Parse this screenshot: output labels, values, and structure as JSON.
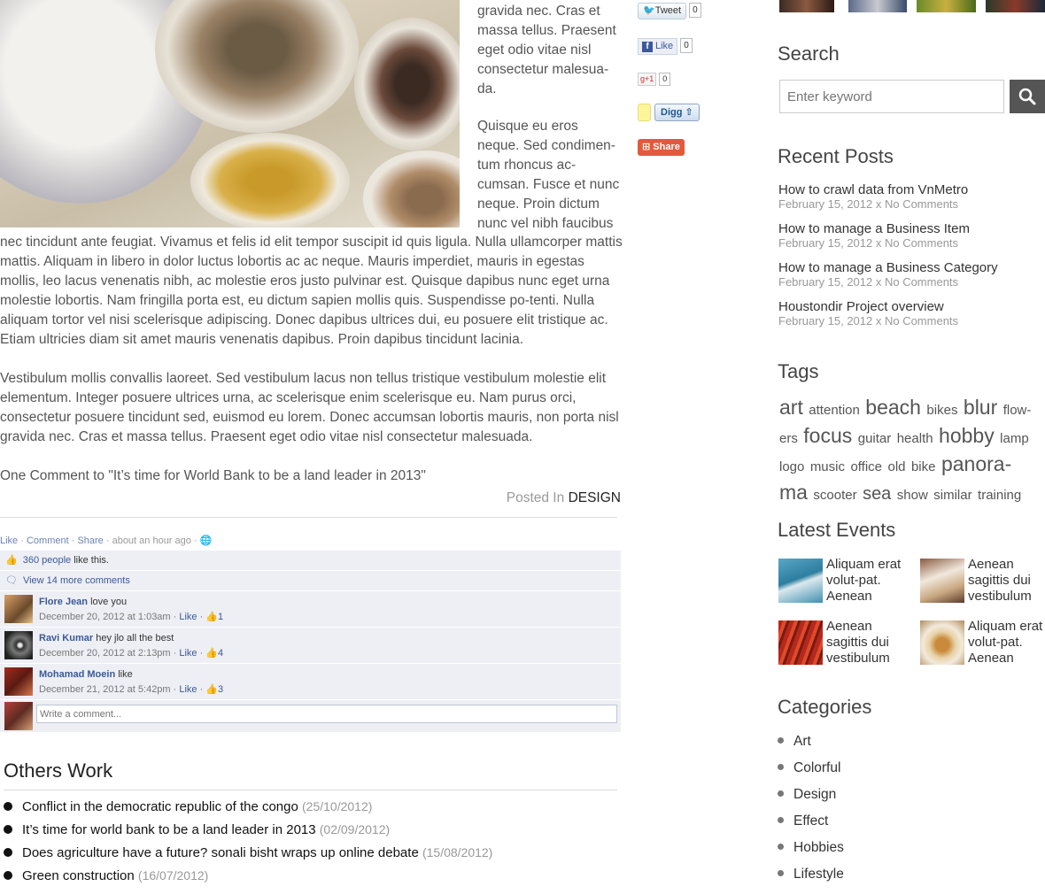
{
  "article": {
    "float_paragraphs": [
      "gravida nec. Cras et massa tellus. Praesent eget odio vitae nisl consectetur malesua-da.",
      "Quisque eu eros neque. Sed condimen-tum rhoncus ac-cumsan. Fusce et nunc neque. Proin dictum nunc vel nibh faucibus"
    ],
    "para1": "nec tincidunt ante feugiat. Vivamus et felis id elit tempor suscipit id quis ligula. Nulla ullamcorper mattis mattis. Aliquam in libero in dolor luctus lobortis ac ac neque. Mauris imperdiet, mauris in egestas mollis, leo lacus venenatis nibh, ac molestie eros justo pulvinar est. Quisque dapibus nunc eget urna molestie lobortis. Nam fringilla porta est, eu dictum sapien mollis quis. Suspendisse po-tenti. Nulla aliquam tortor vel nisi scelerisque adipiscing. Donec dapibus ultrices dui, eu posuere elit tristique ac. Etiam ultricies diam sit amet mauris venenatis dapibus. Proin dapibus tincidunt lacinia.",
    "para2": "Vestibulum mollis convallis laoreet. Sed vestibulum lacus non tellus tristique vestibulum molestie elit elementum. Integer posuere ultrices urna, ac scelerisque enim scelerisque eu. Nam purus orci, consectetur posuere tincidunt sed, euismod eu lorem. Donec accumsan lobortis mauris, non porta nisl gravida nec. Cras et massa tellus. Praesent eget odio vitae nisl consectetur malesuada.",
    "comment_title": "One Comment to \"It’s time for World Bank to be a land leader in 2013\"",
    "posted_in_label": "Posted In",
    "posted_in_category": "DESIGN"
  },
  "share": {
    "tweet_label": "Tweet",
    "tweet_count": "0",
    "fb_like_label": "Like",
    "fb_like_count": "0",
    "gplus_label": "+1",
    "gplus_count": "0",
    "digg_label": "Digg",
    "share_label": "Share"
  },
  "fb": {
    "actions": {
      "like": "Like",
      "comment": "Comment",
      "share": "Share",
      "time": "about an hour ago"
    },
    "likes_link": "360 people",
    "likes_text": "like this.",
    "more_comments": "View 14 more comments",
    "comments": [
      {
        "name": "Flore Jean",
        "text": "love you",
        "date": "December 20, 2012 at 1:03am",
        "like": "Like",
        "count": "1"
      },
      {
        "name": "Ravi Kumar",
        "text": "hey jlo all the best",
        "date": "December 20, 2012 at 2:13pm",
        "like": "Like",
        "count": "4"
      },
      {
        "name": "Mohamad Moein",
        "text": "like",
        "date": "December 21, 2012 at 5:42pm",
        "like": "Like",
        "count": "3"
      }
    ],
    "write_placeholder": "Write a comment..."
  },
  "others_work": {
    "title": "Others Work",
    "items": [
      {
        "title": "Conflict in the democratic republic of the congo",
        "date": "(25/10/2012)"
      },
      {
        "title": "It’s time for world bank to be a land leader in 2013",
        "date": "(02/09/2012)"
      },
      {
        "title": "Does agriculture have a future? sonali bisht wraps up online debate",
        "date": "(15/08/2012)"
      },
      {
        "title": "Green construction",
        "date": "(16/07/2012)"
      }
    ]
  },
  "sidebar": {
    "search": {
      "title": "Search",
      "placeholder": "Enter keyword"
    },
    "recent_posts": {
      "title": "Recent Posts",
      "items": [
        {
          "title": "How to crawl data from VnMetro",
          "meta": "February 15, 2012 x No Comments"
        },
        {
          "title": "How to manage a Business Item",
          "meta": "February 15, 2012 x No Comments"
        },
        {
          "title": "How to manage a Business Category",
          "meta": "February 15, 2012 x No Comments"
        },
        {
          "title": "Houstondir Project overview",
          "meta": "February 15, 2012 x No Comments"
        }
      ]
    },
    "tags": {
      "title": "Tags",
      "items": [
        {
          "label": "art",
          "weight": 3
        },
        {
          "label": "attention",
          "weight": 1
        },
        {
          "label": "beach",
          "weight": 3
        },
        {
          "label": "bikes",
          "weight": 1
        },
        {
          "label": "blur",
          "weight": 3
        },
        {
          "label": "flow-ers",
          "weight": 1
        },
        {
          "label": "focus",
          "weight": 3
        },
        {
          "label": "guitar",
          "weight": 1
        },
        {
          "label": "health",
          "weight": 1
        },
        {
          "label": "hobby",
          "weight": 3
        },
        {
          "label": "lamp",
          "weight": 1
        },
        {
          "label": "logo",
          "weight": 1
        },
        {
          "label": "music",
          "weight": 1
        },
        {
          "label": "office",
          "weight": 1
        },
        {
          "label": "old",
          "weight": 1
        },
        {
          "label": "bike",
          "weight": 1
        },
        {
          "label": "panora-ma",
          "weight": 3
        },
        {
          "label": "scooter",
          "weight": 1
        },
        {
          "label": "sea",
          "weight": 2
        },
        {
          "label": "show",
          "weight": 1
        },
        {
          "label": "similar",
          "weight": 1
        },
        {
          "label": "training",
          "weight": 1
        }
      ]
    },
    "events": {
      "title": "Latest Events",
      "items": [
        {
          "text": "Aliquam erat volut-pat. Aenean"
        },
        {
          "text": "Aenean sagittis dui vestibulum"
        },
        {
          "text": "Aenean sagittis dui vestibulum"
        },
        {
          "text": "Aliquam erat volut-pat. Aenean"
        }
      ]
    },
    "categories": {
      "title": "Categories",
      "items": [
        "Art",
        "Colorful",
        "Design",
        "Effect",
        "Hobbies",
        "Lifestyle"
      ]
    }
  }
}
